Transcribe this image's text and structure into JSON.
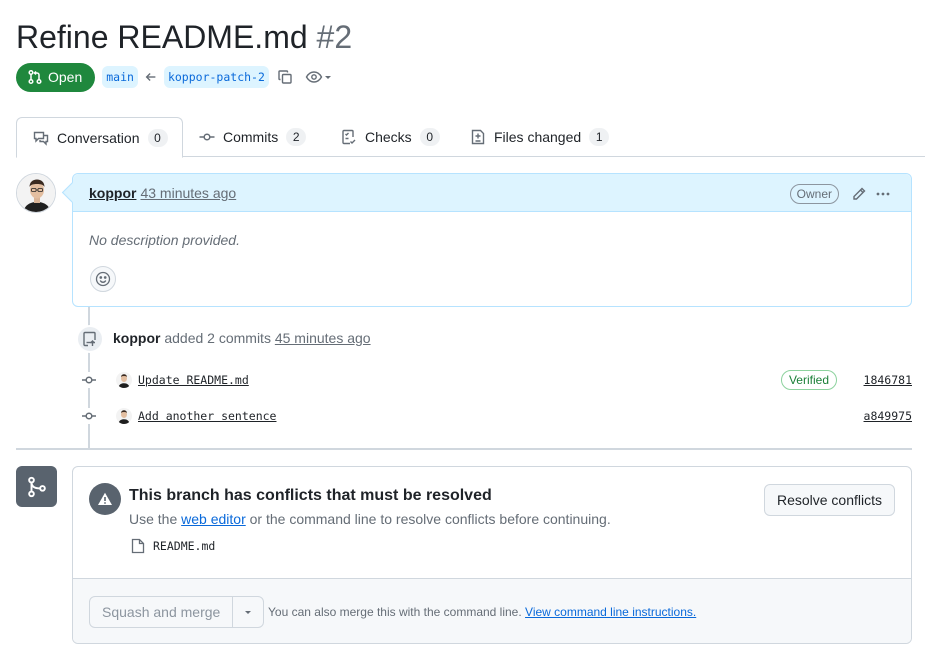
{
  "header": {
    "title": "Refine README.md",
    "number": "#2",
    "state_label": "Open",
    "base_branch": "main",
    "head_branch": "koppor-patch-2"
  },
  "tabs": [
    {
      "label": "Conversation",
      "count": "0",
      "icon": "comment-discussion-icon"
    },
    {
      "label": "Commits",
      "count": "2",
      "icon": "git-commit-icon"
    },
    {
      "label": "Checks",
      "count": "0",
      "icon": "checklist-icon"
    },
    {
      "label": "Files changed",
      "count": "1",
      "icon": "file-diff-icon"
    }
  ],
  "comment": {
    "author": "koppor",
    "time": "43 minutes ago",
    "badge": "Owner",
    "body": "No description provided."
  },
  "timeline": {
    "push_event": {
      "actor": "koppor",
      "action": "added 2 commits",
      "time": "45 minutes ago"
    },
    "commits": [
      {
        "message": "Update README.md",
        "verified": "Verified",
        "sha": "1846781"
      },
      {
        "message": "Add another sentence",
        "verified": "",
        "sha": "a849975"
      }
    ]
  },
  "merge": {
    "conflict_title": "This branch has conflicts that must be resolved",
    "desc_prefix": "Use the ",
    "desc_link": "web editor",
    "desc_suffix": " or the command line to resolve conflicts before continuing.",
    "conflict_file": "README.md",
    "resolve_label": "Resolve conflicts",
    "merge_button": "Squash and merge",
    "hint_text": "You can also merge this with the command line. ",
    "hint_link": "View command line instructions."
  },
  "colors": {
    "open_green": "#1f883d",
    "link_blue": "#0969da",
    "comment_header_bg": "#ddf4ff",
    "verified_green": "#1a7f37"
  }
}
